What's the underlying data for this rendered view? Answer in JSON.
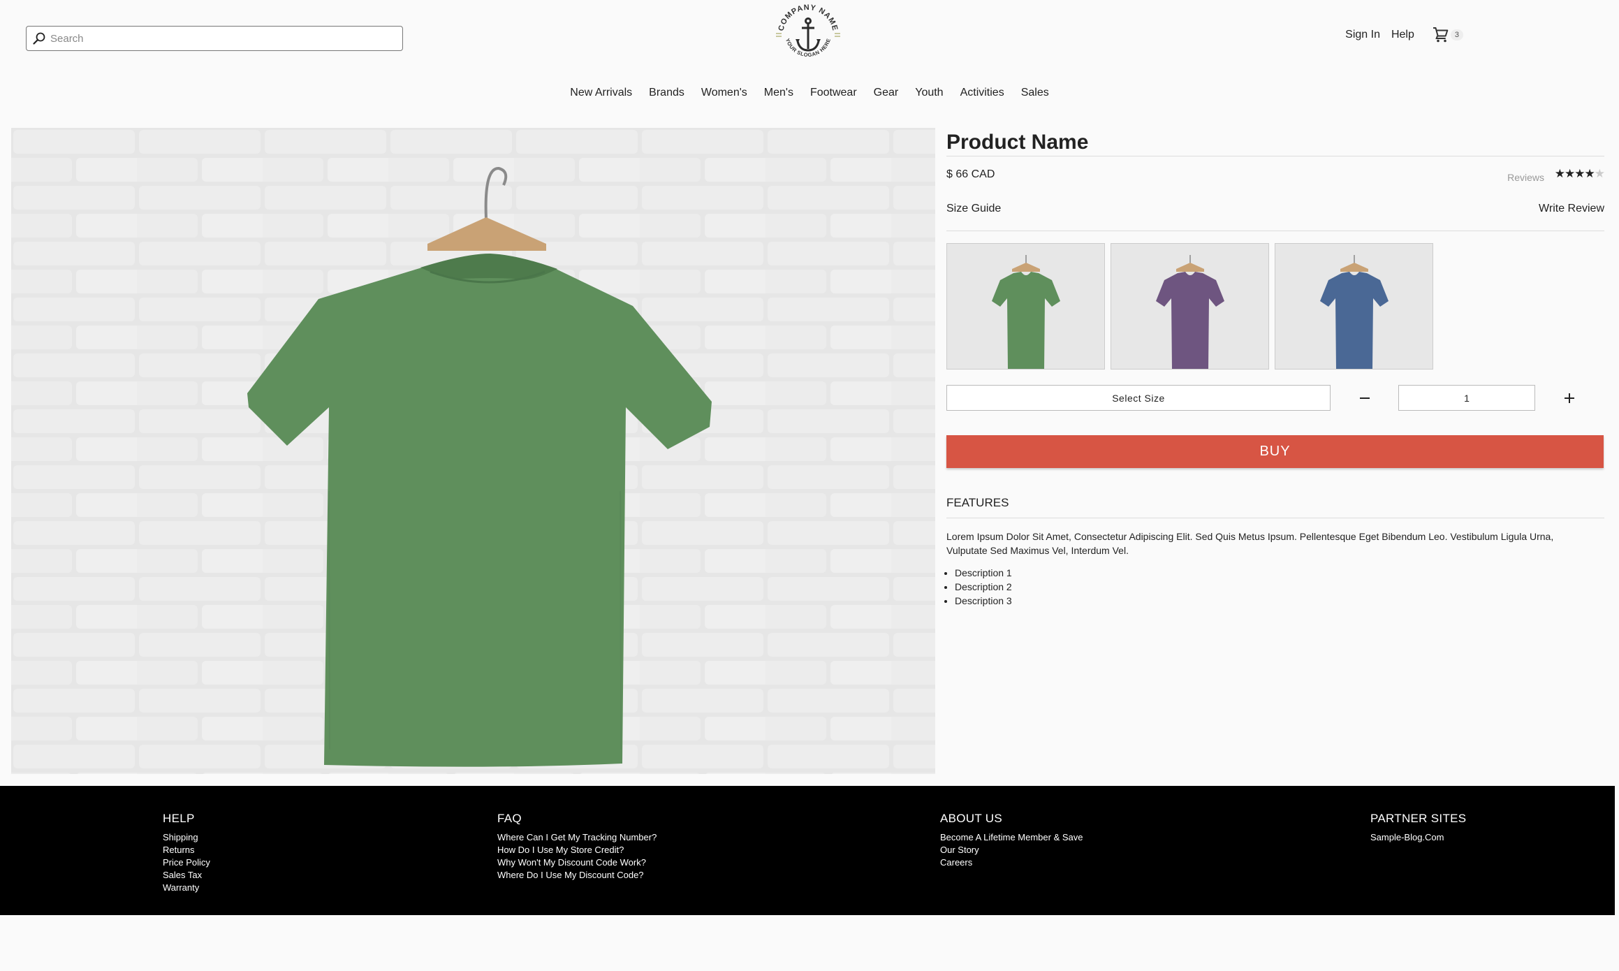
{
  "header": {
    "search_placeholder": "Search",
    "sign_in": "Sign In",
    "help": "Help",
    "cart_count": "3",
    "logo": {
      "company": "COMPANY NAME",
      "slogan": "YOUR SLOGAN HERE"
    }
  },
  "nav": [
    "New Arrivals",
    "Brands",
    "Women's",
    "Men's",
    "Footwear",
    "Gear",
    "Youth",
    "Activities",
    "Sales"
  ],
  "product": {
    "title": "Product Name",
    "price": "$ 66 CAD",
    "reviews_label": "Reviews",
    "rating": 4,
    "rating_max": 5,
    "size_guide": "Size Guide",
    "write_review": "Write Review",
    "color_variants": [
      {
        "name": "green",
        "color": "#5f8f5c"
      },
      {
        "name": "purple",
        "color": "#6e5580"
      },
      {
        "name": "blue",
        "color": "#4a6895"
      }
    ],
    "select_size": "Select Size",
    "quantity": "1",
    "buy": "BUY",
    "features_title": "FEATURES",
    "features_text": "Lorem Ipsum Dolor Sit Amet, Consectetur Adipiscing Elit. Sed Quis Metus Ipsum. Pellentesque Eget Bibendum Leo. Vestibulum Ligula Urna, Vulputate Sed Maximus Vel, Interdum Vel.",
    "descriptions": [
      "Description 1",
      "Description 2",
      "Description 3"
    ]
  },
  "footer": {
    "help": {
      "title": "HELP",
      "links": [
        "Shipping",
        "Returns",
        "Price Policy",
        "Sales Tax",
        "Warranty"
      ]
    },
    "faq": {
      "title": "FAQ",
      "links": [
        "Where Can I Get My Tracking Number?",
        "How Do I Use My Store Credit?",
        "Why Won't My Discount Code Work?",
        "Where Do I Use My Discount Code?"
      ]
    },
    "about": {
      "title": "ABOUT US",
      "links": [
        "Become A Lifetime Member & Save",
        "Our Story",
        "Careers"
      ]
    },
    "partners": {
      "title": "PARTNER SITES",
      "links": [
        "Sample-Blog.Com"
      ]
    }
  },
  "colors": {
    "accent": "#d75544",
    "footer_bg": "#000000"
  }
}
